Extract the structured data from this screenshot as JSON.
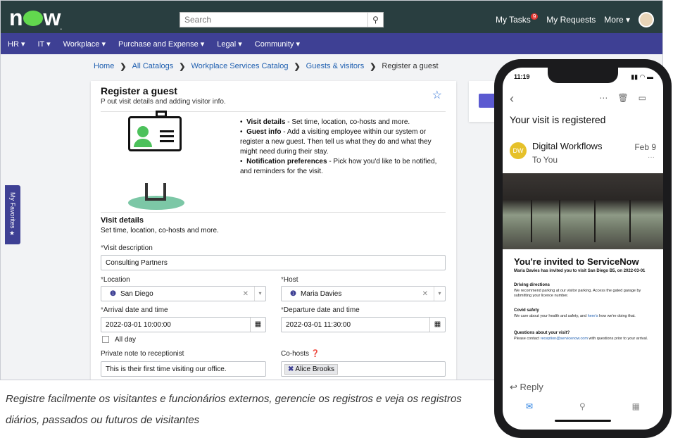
{
  "topbar": {
    "logo": "now",
    "search_placeholder": "Search",
    "my_tasks": "My Tasks",
    "tasks_count": "9",
    "my_requests": "My Requests",
    "more": "More ▾"
  },
  "nav": [
    "HR ▾",
    "IT ▾",
    "Workplace ▾",
    "Purchase and Expense ▾",
    "Legal ▾",
    "Community ▾"
  ],
  "breadcrumb": [
    "Home",
    "All Catalogs",
    "Workplace Services Catalog",
    "Guests & visitors",
    "Register a guest"
  ],
  "form": {
    "title": "Register a guest",
    "subtitle": "P                                         out visit details and adding visitor info.",
    "bullets": [
      {
        "b": "Visit details",
        "t": " - Set time, location, co-hosts and more."
      },
      {
        "b": "Guest info",
        "t": " - Add a visiting employee within our system or register a new guest. Then tell us what they do and what they might need during their stay."
      },
      {
        "b": "Notification preferences",
        "t": " - Pick how you'd like to be notified, and reminders for the visit."
      }
    ],
    "section_title": "Visit details",
    "section_sub": "Set time, location, co-hosts and more.",
    "visit_desc_label": "Visit description",
    "visit_desc_value": "Consulting Partners",
    "location_label": "Location",
    "location_value": "San Diego",
    "host_label": "Host",
    "host_value": "Maria Davies",
    "arrival_label": "Arrival date and time",
    "arrival_value": "2022-03-01 10:00:00",
    "departure_label": "Departure date and time",
    "departure_value": "2022-03-01 11:30:00",
    "allday_label": "All day",
    "note_label": "Private note to receptionist",
    "note_value": "This is their first time visiting our office.",
    "cohosts_label": "Co-hosts",
    "cohost_chip": "Alice Brooks"
  },
  "favorites_label": "My Favorites ★",
  "caption": "Registre facilmente os visitantes e funcionários externos, gerencie os registros e veja os registros diários, passados ou futuros de visitantes",
  "phone": {
    "time": "11:19",
    "subject": "Your visit is registered",
    "avatar": "DW",
    "from": "Digital Workflows",
    "to": "To You",
    "date": "Feb 9",
    "invite_title": "You're invited to ServiceNow",
    "invite_line": "Maria Davies has invited you to visit San Diego B5, on 2022-03-01",
    "h1": "Driving directions",
    "t1": "We recommend parking at our visitor parking.  Access the gated garage by submitting your licence number.",
    "h2": "Covid safety",
    "t2a": "We care about your health and safety, and ",
    "t2link": "here's",
    "t2b": " how we're doing that.",
    "h3": "Questions about your visit?",
    "t3a": "Please contact ",
    "t3link": "reception@servicenow.com",
    "t3b": " with questions prior to your arrival.",
    "reply": "Reply"
  }
}
